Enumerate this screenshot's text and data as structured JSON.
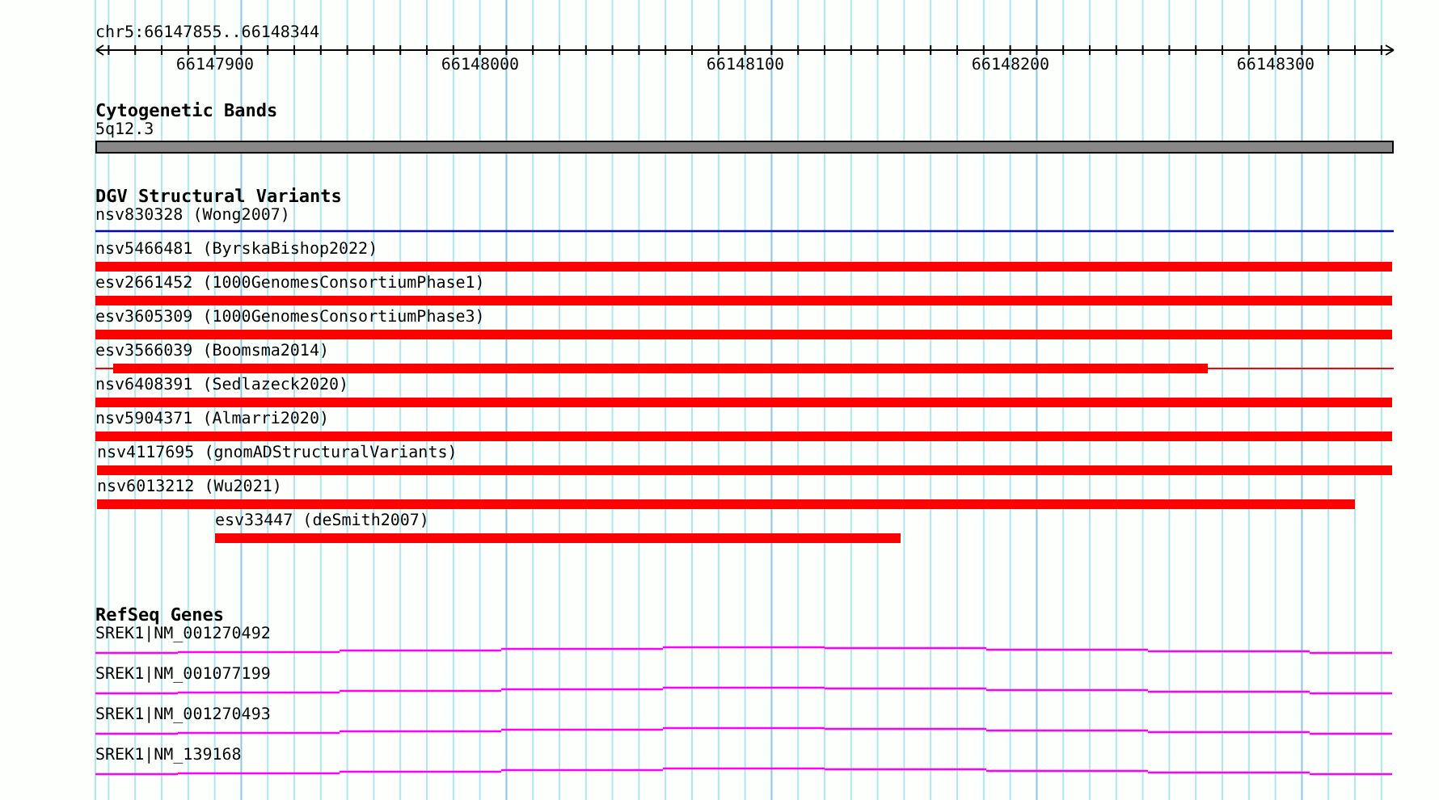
{
  "ruler": {
    "title": "chr5:66147855..66148344",
    "ticks": [
      "66147900",
      "66148000",
      "66148100",
      "66148200",
      "66148300"
    ]
  },
  "tracks": [
    {
      "kind": "bands",
      "title": "Cytogenetic Bands",
      "features": [
        {
          "label": "5q12.3",
          "kind": "band"
        }
      ]
    },
    {
      "kind": "variants",
      "title": "DGV Structural Variants",
      "features": [
        {
          "label": "nsv830328 (Wong2007)",
          "kind": "line"
        },
        {
          "label": "nsv5466481 (ByrskaBishop2022)",
          "kind": "bar"
        },
        {
          "label": "esv2661452 (1000GenomesConsortiumPhase1)",
          "kind": "bar"
        },
        {
          "label": "esv3605309 (1000GenomesConsortiumPhase3)",
          "kind": "bar"
        },
        {
          "label": "esv3566039 (Boomsma2014)",
          "kind": "partial"
        },
        {
          "label": "nsv6408391 (Sedlazeck2020)",
          "kind": "bar"
        },
        {
          "label": "nsv5904371 (Almarri2020)",
          "kind": "bar"
        },
        {
          "label": "nsv4117695 (gnomADStructuralVariants)",
          "kind": "bar"
        },
        {
          "label": "nsv6013212 (Wu2021)",
          "kind": "bar"
        },
        {
          "label": "esv33447 (deSmith2007)",
          "kind": "bar"
        }
      ]
    },
    {
      "kind": "genes",
      "title": "RefSeq Genes",
      "features": [
        {
          "label": "SREK1|NM_001270492",
          "kind": "gene"
        },
        {
          "label": "SREK1|NM_001077199",
          "kind": "gene"
        },
        {
          "label": "SREK1|NM_001270493",
          "kind": "gene"
        },
        {
          "label": "SREK1|NM_139168",
          "kind": "gene"
        }
      ]
    }
  ]
}
